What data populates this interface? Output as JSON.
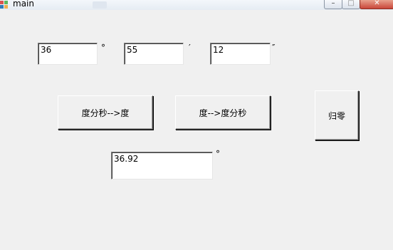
{
  "window": {
    "title": "main",
    "controls": {
      "minimize": "–",
      "maximize": "□",
      "close": "✕"
    }
  },
  "inputs": {
    "degrees": "36",
    "minutes": "55",
    "seconds": "12"
  },
  "units": {
    "degree": "°",
    "minute": "′",
    "second": "″"
  },
  "buttons": {
    "dms_to_deg": "度分秒-->度",
    "deg_to_dms": "度-->度分秒",
    "reset": "归零"
  },
  "result": {
    "value": "36.92",
    "unit": "°"
  }
}
